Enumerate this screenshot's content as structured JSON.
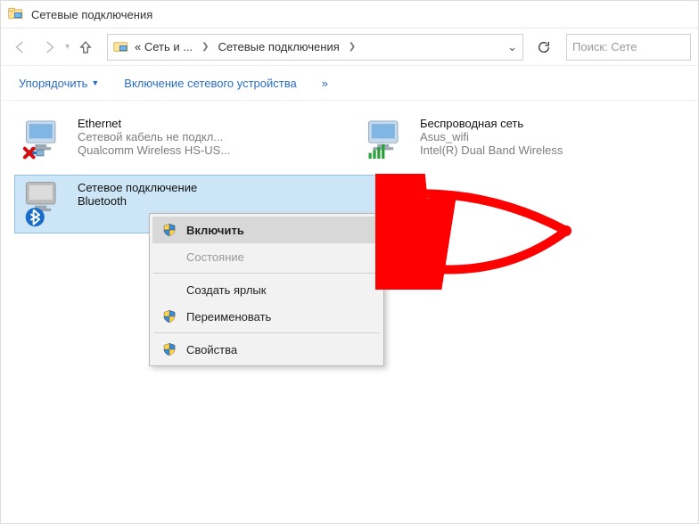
{
  "window": {
    "title": "Сетевые подключения"
  },
  "breadcrumb": {
    "root": "«  Сеть и ...",
    "current": "Сетевые подключения"
  },
  "search": {
    "placeholder": "Поиск: Сете"
  },
  "toolbar": {
    "organize": "Упорядочить",
    "enable_device": "Включение сетевого устройства",
    "more": "»"
  },
  "connections": {
    "ethernet": {
      "name": "Ethernet",
      "status": "Сетевой кабель не подкл...",
      "device": "Qualcomm Wireless HS-US..."
    },
    "wifi": {
      "name": "Беспроводная сеть",
      "status": "Asus_wifi",
      "device": "Intel(R) Dual Band Wireless"
    },
    "bluetooth": {
      "name": "Сетевое подключение Bluetooth",
      "line1": "Сетевое подключение",
      "line2": "Bluetooth"
    }
  },
  "context_menu": {
    "enable": "Включить",
    "status": "Состояние",
    "shortcut": "Создать ярлык",
    "rename": "Переименовать",
    "properties": "Свойства"
  },
  "colors": {
    "link": "#2a6cc6",
    "selection": "#cde6f7",
    "arrow": "#ff0000"
  }
}
